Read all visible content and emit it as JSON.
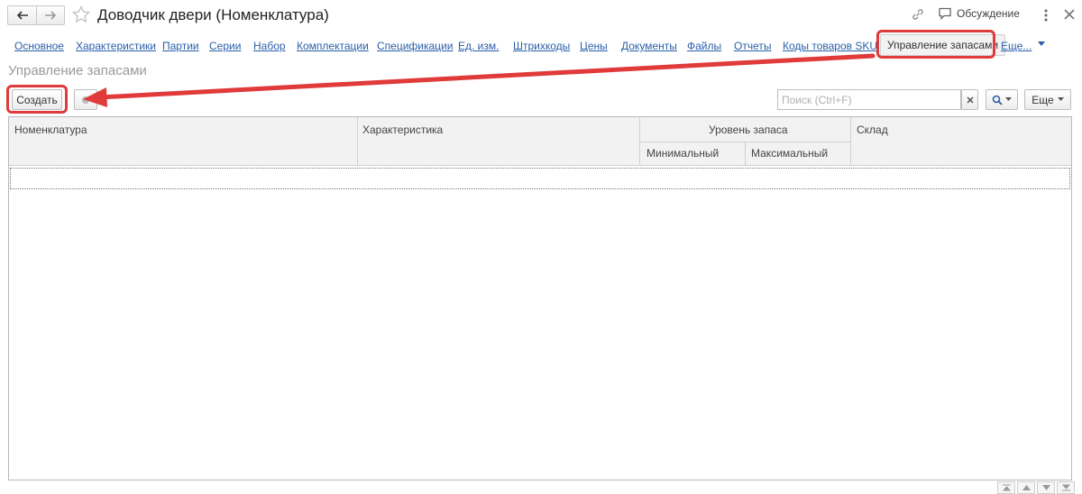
{
  "window": {
    "title": "Доводчик двери (Номенклатура)",
    "discussion_label": "Обсуждение"
  },
  "tabs": [
    {
      "label": "Основное"
    },
    {
      "label": "Характеристики"
    },
    {
      "label": "Партии"
    },
    {
      "label": "Серии"
    },
    {
      "label": "Набор"
    },
    {
      "label": "Комплектации"
    },
    {
      "label": "Спецификации"
    },
    {
      "label": "Ед. изм."
    },
    {
      "label": "Штрихкоды"
    },
    {
      "label": "Цены"
    },
    {
      "label": "Документы"
    },
    {
      "label": "Файлы"
    },
    {
      "label": "Отчеты"
    },
    {
      "label": "Коды товаров SKU"
    }
  ],
  "active_tab": {
    "label": "Управление запасами"
  },
  "tab_more": {
    "label": "Еще..."
  },
  "section": {
    "title": "Управление запасами"
  },
  "toolbar": {
    "create_label": "Создать",
    "search_placeholder": "Поиск (Ctrl+F)",
    "more_label": "Еще"
  },
  "table": {
    "columns": {
      "nomenclature": "Номенклатура",
      "characteristic": "Характеристика",
      "stock_level": "Уровень запаса",
      "minimum": "Минимальный",
      "maximum": "Максимальный",
      "warehouse": "Склад"
    },
    "rows": []
  },
  "colors": {
    "highlight": "#e03a3a",
    "link": "#2a5ea8"
  }
}
